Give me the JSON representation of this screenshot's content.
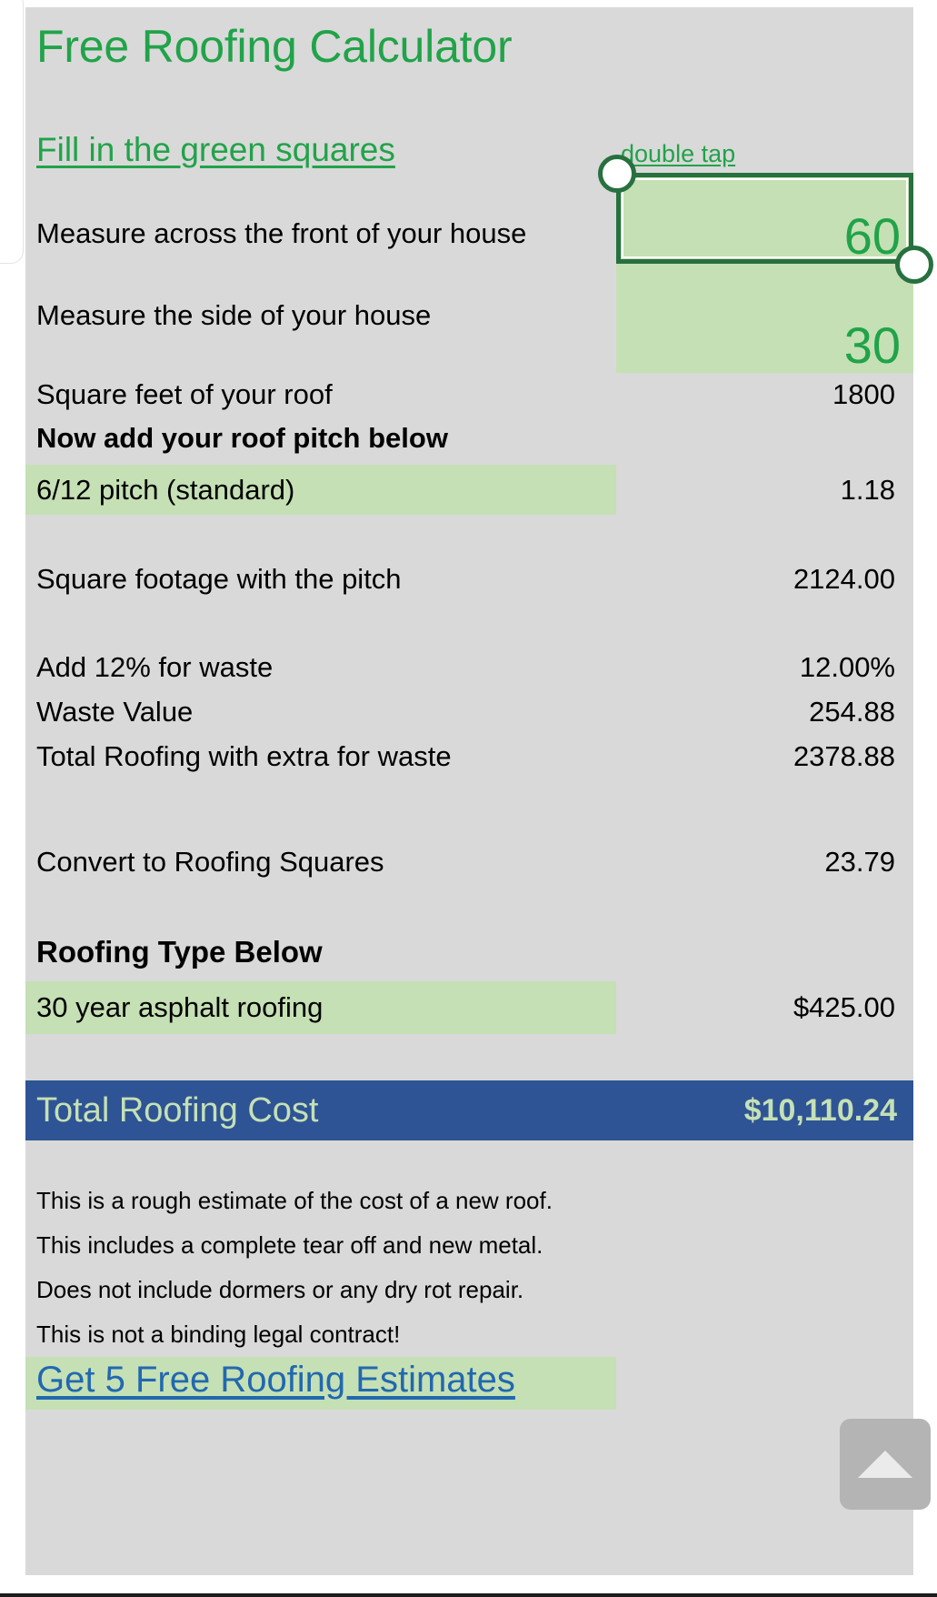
{
  "app": {
    "title": "Free Roofing Calculator",
    "instruction_link": "Fill in the green squares",
    "hint": "double tap"
  },
  "colors": {
    "accent_green": "#21a349",
    "cell_green": "#c5e0b4",
    "sheet_gray": "#d9d9d9",
    "total_blue": "#2e5496",
    "link_blue": "#2168b0",
    "selection_border": "#27703f"
  },
  "inputs": [
    {
      "label": "Measure across the front of your house",
      "value": "60"
    },
    {
      "label": "Measure the side of your house",
      "value": "30"
    }
  ],
  "rows": [
    {
      "label": "Square feet of your roof",
      "value": "1800"
    },
    {
      "label": "Now add your roof pitch below",
      "value": ""
    },
    {
      "label": "6/12 pitch (standard)",
      "value": "1.18"
    },
    {
      "label": "Square footage with the pitch",
      "value": "2124.00"
    },
    {
      "label": "Add 12% for waste",
      "value": "12.00%"
    },
    {
      "label": "Waste Value",
      "value": "254.88"
    },
    {
      "label": "Total Roofing with extra for waste",
      "value": "2378.88"
    },
    {
      "label": "Convert to Roofing Squares",
      "value": "23.79"
    },
    {
      "label": "Roofing Type Below",
      "value": ""
    },
    {
      "label": "30 year asphalt roofing",
      "value": "$425.00"
    }
  ],
  "total": {
    "label": "Total Roofing Cost",
    "value": "$10,110.24"
  },
  "notes": [
    "This is a rough estimate of the cost of a new roof.",
    "This includes a complete tear off and new metal.",
    "Does not include dormers or any dry rot repair.",
    "This is not a binding legal contract!"
  ],
  "cta": {
    "label": "Get 5 Free Roofing Estimates"
  },
  "scroll_top": {
    "icon": "triangle-up-icon"
  }
}
